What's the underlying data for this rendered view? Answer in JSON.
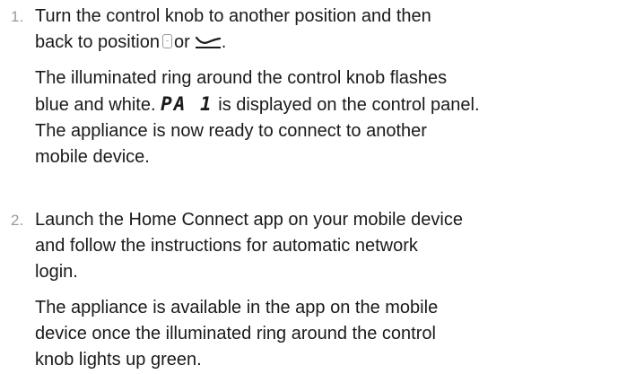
{
  "steps": [
    {
      "number": "1.",
      "instruction_lines": [
        "Turn the control knob to another position and then",
        "back to position",
        "or",
        "."
      ],
      "instruction_icons": [
        "standby-position-symbol",
        "wifi-connect-position-symbol"
      ],
      "result_lines": [
        "The illuminated ring around the control knob flashes",
        "blue and white.",
        "PA 1",
        "is displayed on the control panel.",
        "The appliance is now ready to connect to another",
        "mobile device."
      ]
    },
    {
      "number": "2.",
      "instruction_lines": [
        "Launch the Home Connect app on your mobile device",
        "and follow the instructions for automatic network",
        "login."
      ],
      "result_lines": [
        "The appliance is available in the app on the mobile",
        "device once the illuminated ring around the control",
        "knob lights up green."
      ]
    }
  ]
}
